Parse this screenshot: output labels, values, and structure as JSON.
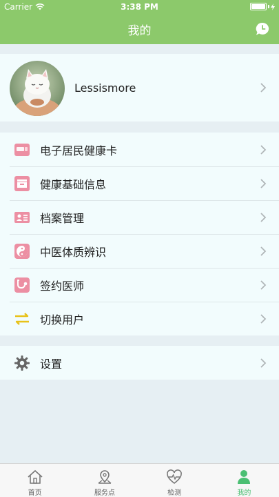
{
  "status_bar": {
    "carrier": "Carrier",
    "time": "3:38 PM"
  },
  "nav": {
    "title": "我的",
    "right_icon": "chat-bubble-icon"
  },
  "profile": {
    "username": "Lessismore",
    "avatar_icon": "cat-avatar"
  },
  "menu_group_1": [
    {
      "label": "电子居民健康卡",
      "icon": "health-card-icon"
    },
    {
      "label": "健康基础信息",
      "icon": "archive-box-icon"
    },
    {
      "label": "档案管理",
      "icon": "id-card-icon"
    },
    {
      "label": "中医体质辨识",
      "icon": "yin-yang-icon"
    },
    {
      "label": "签约医师",
      "icon": "stethoscope-icon"
    },
    {
      "label": "切换用户",
      "icon": "switch-arrows-icon"
    }
  ],
  "menu_group_2": [
    {
      "label": "设置",
      "icon": "gear-icon"
    }
  ],
  "tabs": [
    {
      "label": "首页",
      "icon": "home-icon",
      "active": false
    },
    {
      "label": "服务点",
      "icon": "location-pin-icon",
      "active": false
    },
    {
      "label": "检测",
      "icon": "heart-pulse-icon",
      "active": false
    },
    {
      "label": "我的",
      "icon": "person-icon",
      "active": true
    }
  ],
  "colors": {
    "header_green": "#8cc96b",
    "active_tab": "#4bbf73",
    "icon_pink": "#ec8fa3",
    "icon_yellow": "#e8c21a"
  }
}
